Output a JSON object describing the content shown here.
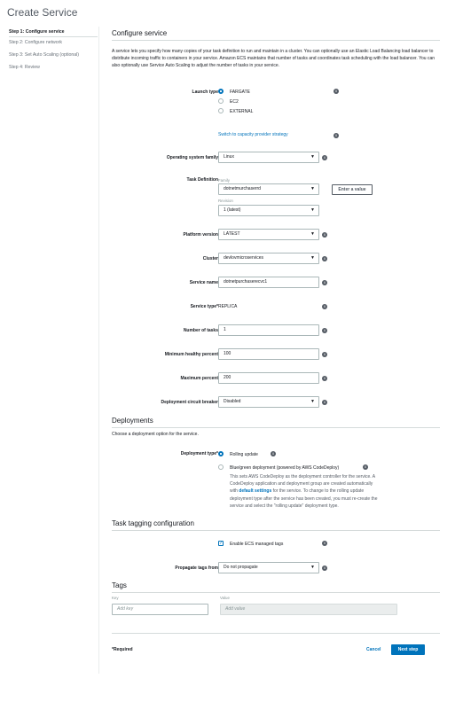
{
  "page": {
    "title": "Create Service"
  },
  "steps": [
    {
      "label": "Step 1: Configure service"
    },
    {
      "label": "Step 2: Configure network"
    },
    {
      "label": "Step 3: Set Auto Scaling (optional)"
    },
    {
      "label": "Step 4: Review"
    }
  ],
  "configure": {
    "title": "Configure service",
    "intro": "A service lets you specify how many copies of your task definition to run and maintain in a cluster. You can optionally use an Elastic Load Balancing load balancer to distribute incoming traffic to containers in your service. Amazon ECS maintains that number of tasks and coordinates task scheduling with the load balancer. You can also optionally use Service Auto Scaling to adjust the number of tasks in your service.",
    "launch_type_label": "Launch type",
    "launch_options": [
      "FARGATE",
      "EC2",
      "EXTERNAL"
    ],
    "launch_selected": "FARGATE",
    "capacity_link": "Switch to capacity provider strategy",
    "os_label": "Operating system family",
    "os_value": "Linux",
    "task_def_label": "Task Definition",
    "family_label": "Family",
    "family_value": "dotnetmurchaserrd",
    "enter_value_button": "Enter a value",
    "revision_label": "Revision",
    "revision_value": "1 (latest)",
    "platform_label": "Platform version",
    "platform_value": "LATEST",
    "cluster_label": "Cluster",
    "cluster_value": "devlovmicroservices",
    "service_name_label": "Service name",
    "service_name_value": "dotnetpurchaserecvc1",
    "service_type_label": "Service type*",
    "service_type_value": "REPLICA",
    "tasks_label": "Number of tasks",
    "tasks_value": "1",
    "min_healthy_label": "Minimum healthy percent",
    "min_healthy_value": "100",
    "max_percent_label": "Maximum percent",
    "max_percent_value": "200",
    "circuit_label": "Deployment circuit breaker",
    "circuit_value": "Disabled"
  },
  "deployments": {
    "title": "Deployments",
    "desc": "Choose a deployment option for the service.",
    "type_label": "Deployment type*",
    "rolling": "Rolling update",
    "bluegreen": "Blue/green deployment (powered by AWS CodeDeploy)",
    "bluegreen_desc_1": "This sets AWS CodeDeploy as the deployment controller for the service. A",
    "bluegreen_desc_2": "CodeDeploy application and deployment group are created automatically",
    "bluegreen_desc_3a": "with ",
    "bluegreen_desc_link": "default settings",
    "bluegreen_desc_3b": " for the service. To change to the rolling update",
    "bluegreen_desc_4": "deployment type after the service has been created, you must re-create the",
    "bluegreen_desc_5": "service and select the \"rolling update\" deployment type."
  },
  "tagging": {
    "title": "Task tagging configuration",
    "ecs_tags_label": "Enable ECS managed tags",
    "propagate_label": "Propagate tags from",
    "propagate_value": "Do not propagate"
  },
  "tags": {
    "title": "Tags",
    "key_header": "Key",
    "value_header": "Value",
    "key_placeholder": "Add key",
    "value_placeholder": "Add value"
  },
  "footer": {
    "required": "*Required",
    "cancel": "Cancel",
    "next": "Next step"
  },
  "icons": {
    "info": "info-icon",
    "caret": "chevron-down-icon",
    "check": "checkmark-icon"
  },
  "colors": {
    "accent": "#0073bb",
    "text": "#16191f",
    "muted": "#545b64",
    "border": "#aab7b8"
  }
}
